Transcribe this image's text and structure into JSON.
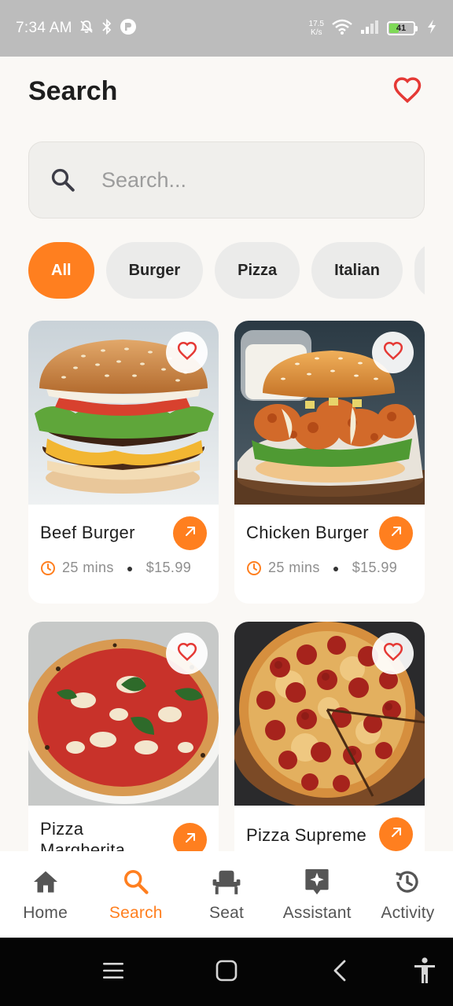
{
  "status_bar": {
    "time": "7:34 AM",
    "net_speed_value": "17.5",
    "net_speed_unit": "K/s",
    "battery_level": "41",
    "icons": [
      "mute-icon",
      "bluetooth-icon",
      "app-notification-icon",
      "wifi-icon",
      "signal-icon",
      "battery-icon",
      "charging-icon"
    ]
  },
  "header": {
    "title": "Search"
  },
  "search": {
    "placeholder": "Search..."
  },
  "categories": [
    {
      "label": "All",
      "active": true
    },
    {
      "label": "Burger",
      "active": false
    },
    {
      "label": "Pizza",
      "active": false
    },
    {
      "label": "Italian",
      "active": false
    }
  ],
  "items": [
    {
      "name": "Beef Burger",
      "time": "25 mins",
      "price": "$15.99"
    },
    {
      "name": "Chicken Burger",
      "time": "25 mins",
      "price": "$15.99"
    },
    {
      "name": "Pizza Margherita",
      "time": "",
      "price": ""
    },
    {
      "name": "Pizza Supreme",
      "time": "",
      "price": ""
    }
  ],
  "bottom_nav": [
    {
      "label": "Home",
      "icon": "home-icon",
      "active": false
    },
    {
      "label": "Search",
      "icon": "search-icon",
      "active": true
    },
    {
      "label": "Seat",
      "icon": "seat-icon",
      "active": false
    },
    {
      "label": "Assistant",
      "icon": "assistant-icon",
      "active": false
    },
    {
      "label": "Activity",
      "icon": "history-icon",
      "active": false
    }
  ],
  "colors": {
    "accent": "#ff7f1f",
    "favorite": "#e53935",
    "background": "#faf8f5"
  }
}
